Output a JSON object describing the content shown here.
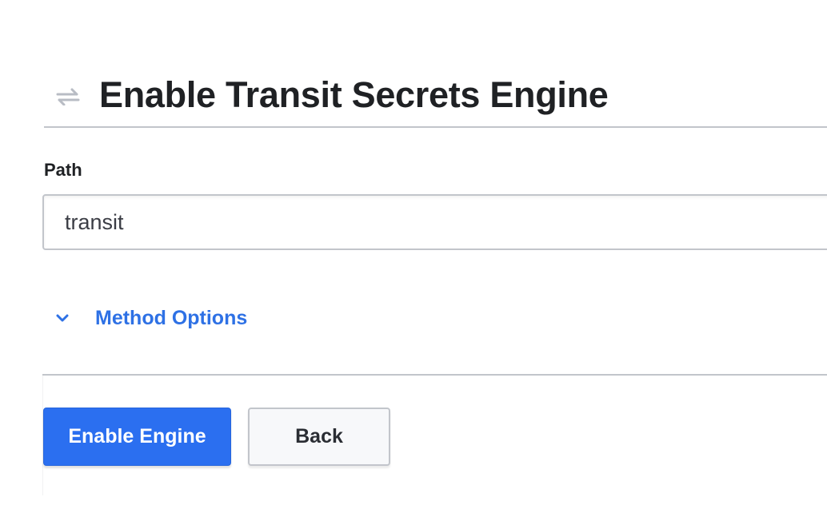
{
  "header": {
    "icon": "transit-arrows-icon",
    "title": "Enable Transit Secrets Engine"
  },
  "form": {
    "path_label": "Path",
    "path_value": "transit"
  },
  "method_options": {
    "icon": "chevron-down-icon",
    "label": "Method Options"
  },
  "actions": {
    "enable_label": "Enable Engine",
    "back_label": "Back"
  },
  "colors": {
    "primary": "#2b6ff0",
    "link": "#2e71e5",
    "border": "#c2c5cb",
    "icon_muted": "#b8bcc4"
  }
}
